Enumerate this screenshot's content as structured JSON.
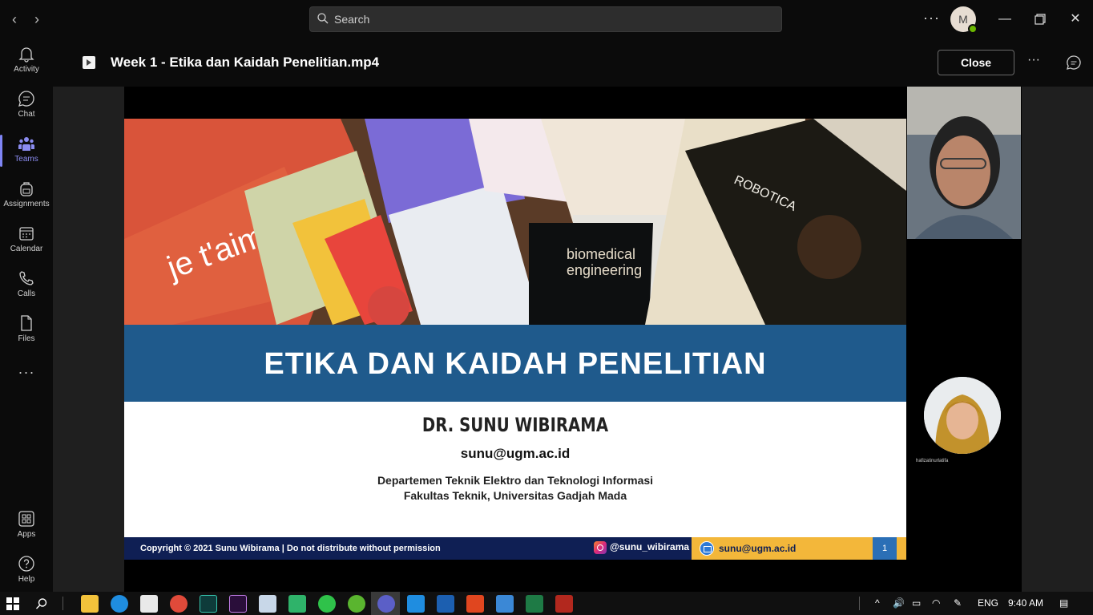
{
  "titlebar": {
    "search_placeholder": "Search",
    "avatar_initial": "M",
    "more_label": "···"
  },
  "rail": {
    "items": [
      {
        "label": "Activity",
        "icon": "bell-icon"
      },
      {
        "label": "Chat",
        "icon": "chat-icon"
      },
      {
        "label": "Teams",
        "icon": "teams-icon",
        "active": true
      },
      {
        "label": "Assignments",
        "icon": "backpack-icon"
      },
      {
        "label": "Calendar",
        "icon": "calendar-icon"
      },
      {
        "label": "Calls",
        "icon": "phone-icon"
      },
      {
        "label": "Files",
        "icon": "file-icon"
      }
    ],
    "more_label": "···",
    "bottom": [
      {
        "label": "Apps",
        "icon": "apps-icon"
      },
      {
        "label": "Help",
        "icon": "help-icon"
      }
    ]
  },
  "file": {
    "title": "Week 1 - Etika dan Kaidah Penelitian.mp4",
    "close_label": "Close",
    "more_label": "···"
  },
  "slide": {
    "banner_text": {
      "title": "ETIKA DAN KAIDAH PENELITIAN",
      "author": "DR. SUNU WIBIRAMA",
      "email": "sunu@ugm.ac.id",
      "dept_line1": "Departemen Teknik Elektro dan Teknologi Informasi",
      "dept_line2": "Fakultas Teknik, Universitas Gadjah Mada"
    },
    "footer": {
      "copyright": "Copyright © 2021 Sunu Wibirama | Do not distribute without permission",
      "instagram": "@sunu_wibirama",
      "email": "sunu@ugm.ac.id",
      "page": "1"
    }
  },
  "participant_name": "hafizatinurlatifa",
  "taskbar": {
    "language": "ENG",
    "time": "9:40 AM"
  },
  "colors": {
    "accent": "#7f85f5",
    "slide_band": "#1f5a8c",
    "slide_footer": "#0f1f54",
    "slide_footer_yellow": "#f3b73a"
  }
}
